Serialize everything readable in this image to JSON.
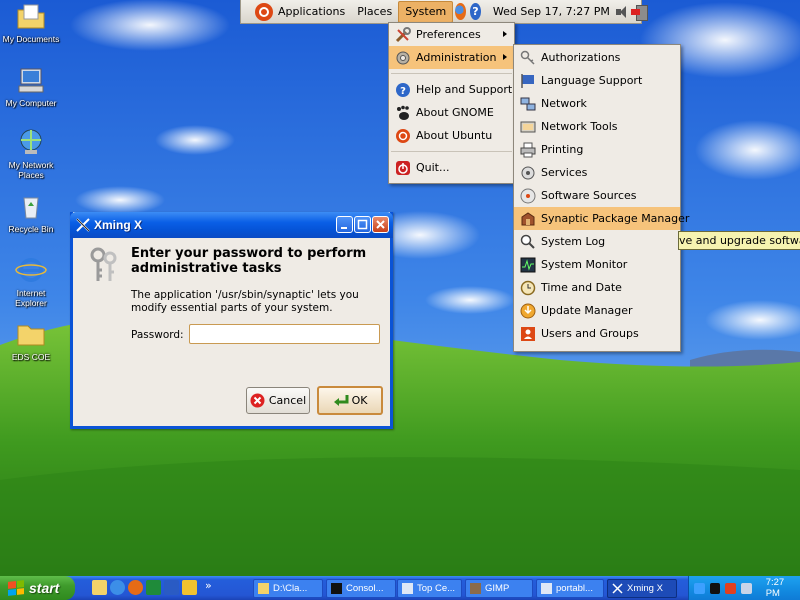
{
  "desktop": {
    "icons": [
      {
        "label": "My Documents",
        "icon": "my-documents-icon"
      },
      {
        "label": "My Computer",
        "icon": "my-computer-icon"
      },
      {
        "label": "My Network Places",
        "icon": "network-places-icon"
      },
      {
        "label": "Recycle Bin",
        "icon": "recycle-bin-icon"
      },
      {
        "label": "Internet Explorer",
        "icon": "internet-explorer-icon"
      },
      {
        "label": "EDS COE",
        "icon": "folder-icon"
      }
    ]
  },
  "gnome_panel": {
    "menus": [
      "Applications",
      "Places",
      "System"
    ],
    "active_menu": "System",
    "clock": "Wed Sep 17,  7:27 PM"
  },
  "system_menu": {
    "items": [
      {
        "label": "Preferences",
        "icon": "preferences-icon",
        "has_submenu": true
      },
      {
        "label": "Administration",
        "icon": "administration-icon",
        "has_submenu": true,
        "highlighted": true
      },
      {
        "label": "Help and Support",
        "icon": "help-icon"
      },
      {
        "label": "About GNOME",
        "icon": "gnome-icon"
      },
      {
        "label": "About Ubuntu",
        "icon": "ubuntu-icon"
      },
      {
        "label": "Quit...",
        "icon": "quit-icon"
      }
    ]
  },
  "admin_menu": {
    "items": [
      {
        "label": "Authorizations",
        "icon": "keys-icon"
      },
      {
        "label": "Language Support",
        "icon": "flag-icon"
      },
      {
        "label": "Network",
        "icon": "network-icon"
      },
      {
        "label": "Network Tools",
        "icon": "network-tools-icon"
      },
      {
        "label": "Printing",
        "icon": "printer-icon"
      },
      {
        "label": "Services",
        "icon": "services-icon"
      },
      {
        "label": "Software Sources",
        "icon": "software-sources-icon"
      },
      {
        "label": "Synaptic Package Manager",
        "icon": "synaptic-icon",
        "highlighted": true
      },
      {
        "label": "System Log",
        "icon": "system-log-icon"
      },
      {
        "label": "System Monitor",
        "icon": "system-monitor-icon"
      },
      {
        "label": "Time and Date",
        "icon": "clock-icon"
      },
      {
        "label": "Update Manager",
        "icon": "update-manager-icon"
      },
      {
        "label": "Users and Groups",
        "icon": "users-groups-icon"
      }
    ]
  },
  "tooltip": {
    "text": "ve and upgrade software"
  },
  "dialog": {
    "title": "Xming X",
    "heading": "Enter your password to perform administrative tasks",
    "message": "The application '/usr/sbin/synaptic' lets you modify essential parts of your system.",
    "password_label": "Password:",
    "password_value": "",
    "cancel_label": "Cancel",
    "ok_label": "OK"
  },
  "taskbar": {
    "start_label": "start",
    "quick_launch": [
      "folder-icon",
      "ie-icon",
      "firefox-icon",
      "excel-icon",
      "word-icon",
      "notes-icon"
    ],
    "overflow": "»",
    "tasks": [
      {
        "label": "D:\\Cla...",
        "icon": "folder-icon"
      },
      {
        "label": "Consol...",
        "icon": "console-icon"
      },
      {
        "label": "Top Ce...",
        "icon": "window-icon"
      },
      {
        "label": "GIMP",
        "icon": "gimp-icon"
      },
      {
        "label": "portabl...",
        "icon": "window-icon"
      },
      {
        "label": "Xming X",
        "icon": "xming-icon",
        "active": true
      }
    ],
    "clock": "7:27 PM"
  },
  "colors": {
    "menu_highlight": "#f6c37b",
    "panel_active": "#ecb165",
    "xp_blue": "#0553d6",
    "start_green": "#3f9b2c"
  }
}
